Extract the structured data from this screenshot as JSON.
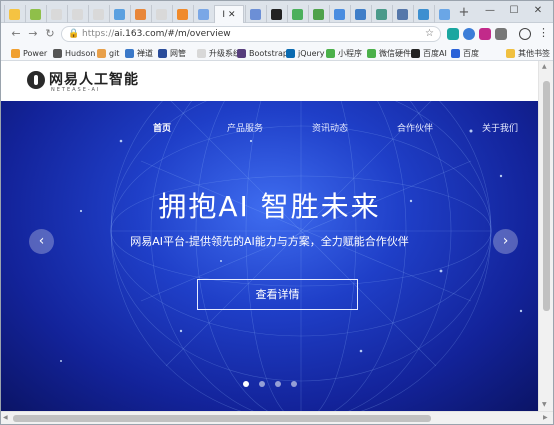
{
  "browser": {
    "tabs": [
      {
        "icon": "tab-favicon",
        "color": "#f5c342"
      },
      {
        "icon": "tab-favicon",
        "color": "#8fbf4a"
      },
      {
        "icon": "document-icon",
        "color": "#d9d9d9"
      },
      {
        "icon": "document-icon",
        "color": "#d9d9d9"
      },
      {
        "icon": "document-icon",
        "color": "#d9d9d9"
      },
      {
        "icon": "tab-favicon",
        "color": "#5aa0e0"
      },
      {
        "icon": "tab-favicon",
        "color": "#e8873a"
      },
      {
        "icon": "document-icon",
        "color": "#d9d9d9"
      },
      {
        "icon": "tab-favicon",
        "color": "#f08a2b"
      },
      {
        "icon": "tab-favicon",
        "color": "#7aa7e6"
      }
    ],
    "active_tab": {
      "label": "I",
      "close": "✕"
    },
    "tabs_after": [
      {
        "icon": "tab-favicon",
        "color": "#6c8fd6"
      },
      {
        "icon": "tab-favicon",
        "color": "#222222"
      },
      {
        "icon": "tab-favicon",
        "color": "#4bb05c"
      },
      {
        "icon": "tab-favicon",
        "color": "#4ea24a"
      },
      {
        "icon": "mic-icon",
        "color": "#4a8de0"
      },
      {
        "icon": "tab-favicon",
        "color": "#3f7ec8"
      },
      {
        "icon": "tab-favicon",
        "color": "#4a9a8a"
      },
      {
        "icon": "tab-favicon",
        "color": "#5577aa"
      },
      {
        "icon": "tab-favicon",
        "color": "#3c8fd0"
      },
      {
        "icon": "tab-favicon",
        "color": "#6aa6e6"
      }
    ],
    "new_tab": "+",
    "window_controls": {
      "minimize": "—",
      "maximize": "☐",
      "close": "✕"
    },
    "url_prefix": "https://",
    "url": "ai.163.com/#/m/overview",
    "accent_color": "#1f3fc8"
  },
  "bookmarks": [
    {
      "label": "Power",
      "color": "#f0a030"
    },
    {
      "label": "Hudson",
      "color": "#555555"
    },
    {
      "label": "git",
      "color": "#e8a04a"
    },
    {
      "label": "禅道",
      "color": "#3a78c8"
    },
    {
      "label": "网管",
      "color": "#2a4c9a"
    },
    {
      "label": "升级系统",
      "color": "#d8d8d8"
    },
    {
      "label": "Bootstrap",
      "color": "#563d7c"
    },
    {
      "label": "jQuery",
      "color": "#0a6ab0"
    },
    {
      "label": "小程序",
      "color": "#4bb04a"
    },
    {
      "label": "微信硬件",
      "color": "#4bb04a"
    },
    {
      "label": "百度AI",
      "color": "#222222"
    },
    {
      "label": "百度",
      "color": "#2a62d8"
    },
    {
      "label": "其他书签",
      "color": "#f0c040"
    }
  ],
  "site": {
    "logo_text": "网易人工智能",
    "logo_sub": "NETEASE-AI",
    "nav": [
      {
        "label": "首页",
        "active": true
      },
      {
        "label": "产品服务",
        "active": false
      },
      {
        "label": "资讯动态",
        "active": false
      },
      {
        "label": "合作伙伴",
        "active": false
      },
      {
        "label": "关于我们",
        "active": false
      }
    ],
    "hero_title": "拥抱AI 智胜未来",
    "hero_subtitle": "网易AI平台-提供领先的AI能力与方案，全力赋能合作伙伴",
    "cta_label": "查看详情",
    "prev_arrow": "‹",
    "next_arrow": "›",
    "carousel": {
      "slides": 4,
      "current": 1
    }
  }
}
